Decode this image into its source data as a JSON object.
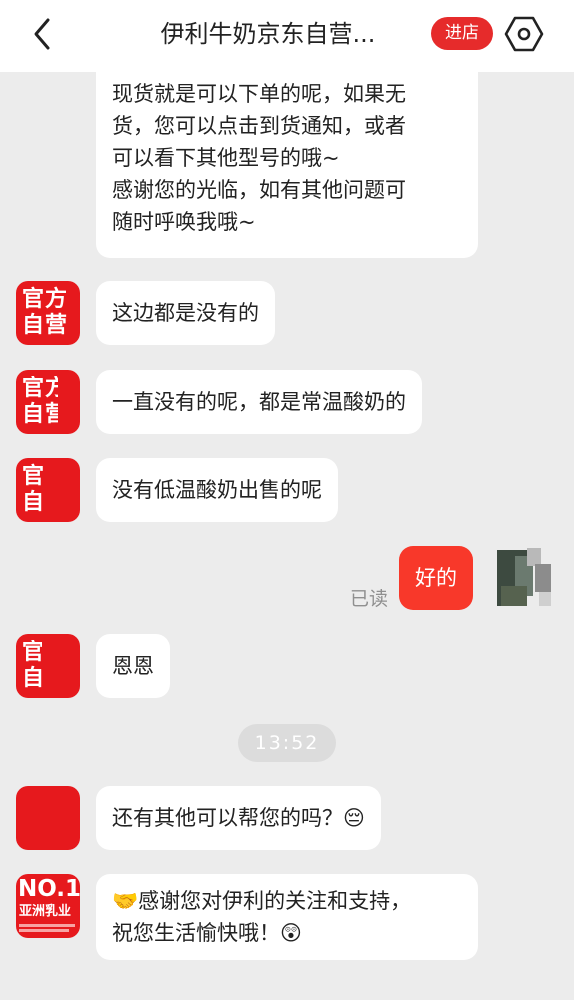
{
  "header": {
    "title": "伊利牛奶京东自营...",
    "shop_button": "进店"
  },
  "messages": {
    "m1": {
      "lines": [
        "现货就是可以下单的呢，如果无",
        "货，您可以点击到货通知，或者",
        "可以看下其他型号的哦~",
        "感谢您的光临，如有其他问题可",
        "随时呼唤我哦~"
      ]
    },
    "m2": "这边都是没有的",
    "m3": "一直没有的呢，都是常温酸奶的",
    "m4": "没有低温酸奶出售的呢",
    "m5": "好的",
    "read_status": "已读",
    "m6": "恩恩",
    "time": "13:52",
    "m7": "还有其他可以帮您的吗？😔",
    "m8": {
      "lines": [
        "🤝感谢您对伊利的关注和支持，",
        "祝您生活愉快哦！😲"
      ]
    }
  },
  "avatars": {
    "official_line1": "官方",
    "official_line2": "自营",
    "official_partial1_line1": "官方",
    "official_partial1_line2": "自营",
    "official_partial2_line1": "官",
    "official_partial2_line2": "自",
    "official_partial3_line1": "官",
    "official_partial3_line2": "自",
    "brand_title": "NO.1",
    "brand_sub": "亚洲乳业"
  },
  "colors": {
    "accent_red": "#e62b2b",
    "my_bubble": "#f8382a",
    "background": "#ececec"
  }
}
